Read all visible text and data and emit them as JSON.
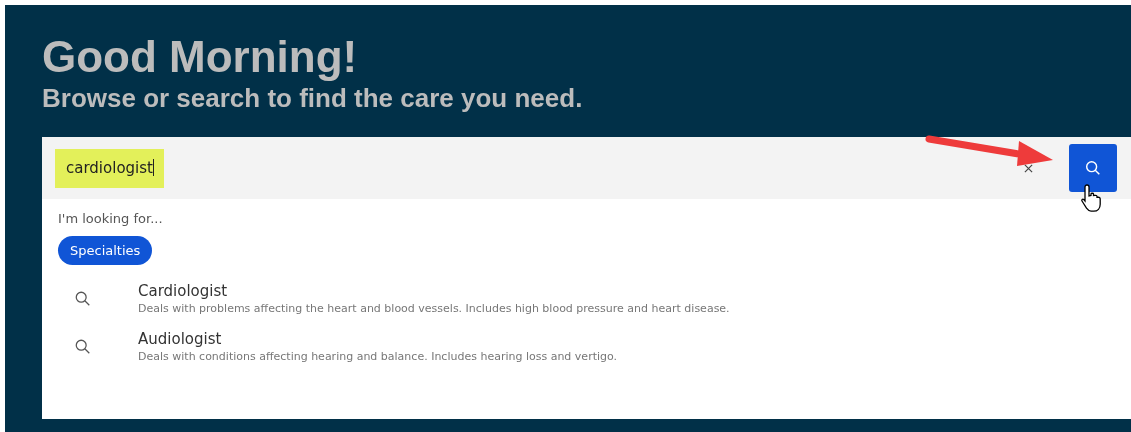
{
  "greeting": "Good Morning!",
  "subtitle": "Browse or search to find the care you need.",
  "search": {
    "value": "cardiologist",
    "highlighted": true
  },
  "dropdown": {
    "prompt": "I'm looking for...",
    "chips": [
      {
        "label": "Specialties",
        "selected": true
      }
    ],
    "results": [
      {
        "title": "Cardiologist",
        "description": "Deals with problems affecting the heart and blood vessels. Includes high blood pressure and heart disease."
      },
      {
        "title": "Audiologist",
        "description": "Deals with conditions affecting hearing and balance. Includes hearing loss and vertigo."
      }
    ]
  }
}
